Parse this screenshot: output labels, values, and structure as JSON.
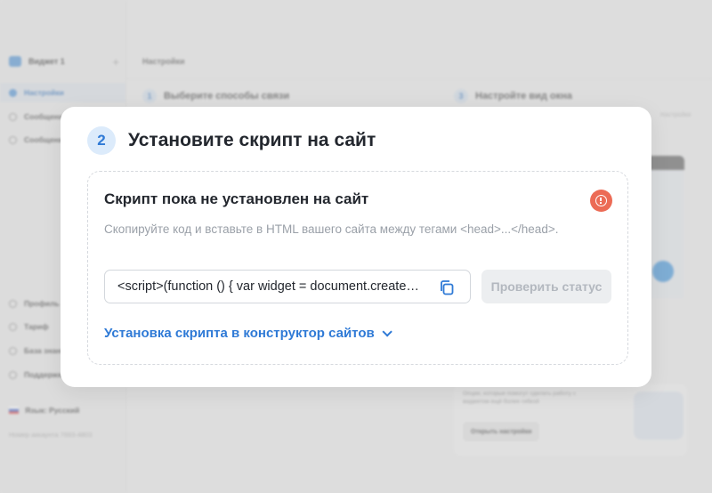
{
  "sidebar": {
    "widget_name": "Виджет 1",
    "add_icon": "plus-icon",
    "items": [
      {
        "label": "Настройки",
        "icon": "gear-icon",
        "active": true
      },
      {
        "label": "Сообщения",
        "icon": "chat-icon"
      },
      {
        "label": "Сообщения",
        "icon": "message-icon"
      }
    ],
    "bottom_items": [
      {
        "label": "Профиль",
        "icon": "user-icon"
      },
      {
        "label": "Тариф",
        "icon": "card-icon"
      },
      {
        "label": "База знаний",
        "icon": "book-icon"
      },
      {
        "label": "Поддержка",
        "icon": "help-icon"
      }
    ],
    "language": "Язык: Русский",
    "account": "Номер аккаунта 7693-4803"
  },
  "content": {
    "breadcrumb": "Настройки",
    "step1": {
      "num": "1",
      "title": "Выберите способы связи"
    },
    "step3": {
      "num": "3",
      "title": "Настройте вид окна"
    },
    "edge_label": "Настройки",
    "info_card": {
      "text": "Опции, которые помогут сделать работу с виджетом ещё более гибкой",
      "button": "Открыть настройки"
    }
  },
  "modal": {
    "step_num": "2",
    "title": "Установите скрипт на сайт",
    "panel_title": "Скрипт пока не установлен на сайт",
    "status_icon": "alert-circle-icon",
    "status_color": "#ec6b55",
    "description": "Скопируйте код и вставьте в HTML вашего сайта между тегами <head>...</head>.",
    "code": "<script>(function () { var widget = document.createElement('script');",
    "copy_icon": "copy-icon",
    "check_button": "Проверить статус",
    "install_link": "Установка скрипта в конструктор сайтов",
    "accent_color": "#2f7ad6"
  }
}
